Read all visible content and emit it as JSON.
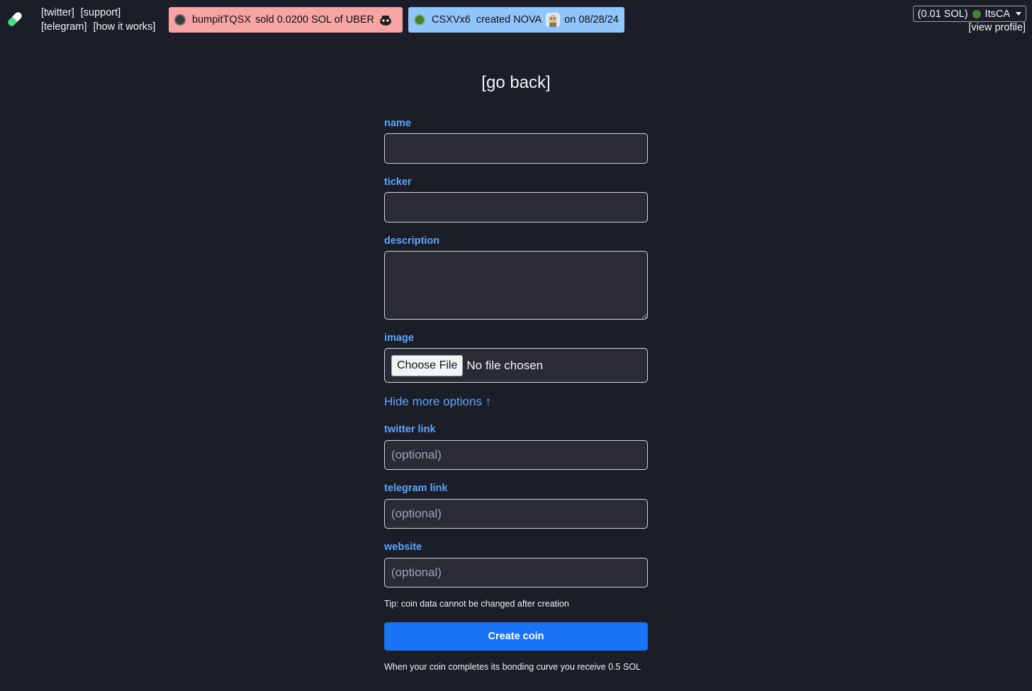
{
  "header": {
    "nav_links": [
      "[twitter]",
      "[support]",
      "[telegram]",
      "[how it works]"
    ],
    "ticker_sell": {
      "user": "bumpitTQSX",
      "action": "sold 0.0200 SOL of UBER",
      "color": "#f7a4a4"
    },
    "ticker_create": {
      "user": "CSXVx6",
      "action": "created NOVA",
      "date": "on 08/28/24",
      "color": "#93c5fd"
    },
    "wallet": {
      "balance": "(0.01 SOL)",
      "username": "ItsCA"
    },
    "view_profile": "[view profile]"
  },
  "form": {
    "go_back": "[go back]",
    "name_label": "name",
    "ticker_label": "ticker",
    "description_label": "description",
    "image_label": "image",
    "choose_file": "Choose File",
    "no_file": "No file chosen",
    "toggle_options": "Hide more options ↑",
    "twitter_label": "twitter link",
    "twitter_placeholder": "(optional)",
    "telegram_label": "telegram link",
    "telegram_placeholder": "(optional)",
    "website_label": "website",
    "website_placeholder": "(optional)",
    "tip": "Tip: coin data cannot be changed after creation",
    "create_button": "Create coin",
    "bonding_note": "When your coin completes its bonding curve you receive 0.5 SOL"
  },
  "colors": {
    "background": "#1b1d28",
    "label": "#60a5fa",
    "button": "#1a73f2",
    "input_bg": "#2a2b37"
  }
}
